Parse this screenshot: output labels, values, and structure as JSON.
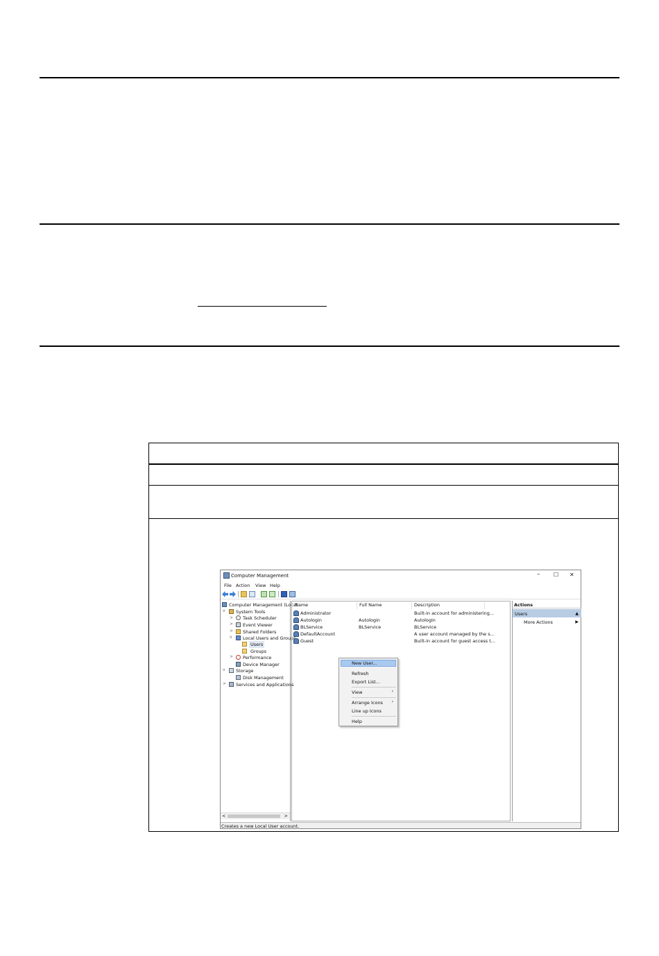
{
  "window": {
    "title": "Computer Management",
    "minimize": "–",
    "maximize": "☐",
    "close": "✕",
    "menu": [
      "File",
      "Action",
      "View",
      "Help"
    ]
  },
  "tree": {
    "root": "Computer Management (Local",
    "system_tools": "System Tools",
    "task_scheduler": "Task Scheduler",
    "event_viewer": "Event Viewer",
    "shared_folders": "Shared Folders",
    "local_users": "Local Users and Groups",
    "users": "Users",
    "groups": "Groups",
    "performance": "Performance",
    "device_manager": "Device Manager",
    "storage": "Storage",
    "disk_management": "Disk Management",
    "services": "Services and Applications"
  },
  "list": {
    "columns": [
      "Name",
      "Full Name",
      "Description"
    ],
    "rows": [
      {
        "name": "Administrator",
        "full_name": "",
        "description": "Built-in account for administering..."
      },
      {
        "name": "Autologin",
        "full_name": "Autologin",
        "description": "Autologin"
      },
      {
        "name": "BLService",
        "full_name": "BLService",
        "description": "BLService"
      },
      {
        "name": "DefaultAccount",
        "full_name": "",
        "description": "A user account managed by the s..."
      },
      {
        "name": "Guest",
        "full_name": "",
        "description": "Built-in account for guest access t..."
      }
    ]
  },
  "context_menu": {
    "new_user": "New User...",
    "refresh": "Refresh",
    "export_list": "Export List...",
    "view": "View",
    "arrange_icons": "Arrange Icons",
    "line_up_icons": "Line up Icons",
    "help": "Help",
    "submenu_arrow": "›"
  },
  "actions": {
    "header": "Actions",
    "users": "Users",
    "collapse_arrow": "▲",
    "more_actions": "More Actions",
    "more_arrow": "▶"
  },
  "status": "Creates a new Local User account.",
  "scroll": {
    "left": "<",
    "right": ">"
  },
  "colors": {
    "selection": "#b8cce4",
    "menu_highlight": "#a9c9ef"
  }
}
